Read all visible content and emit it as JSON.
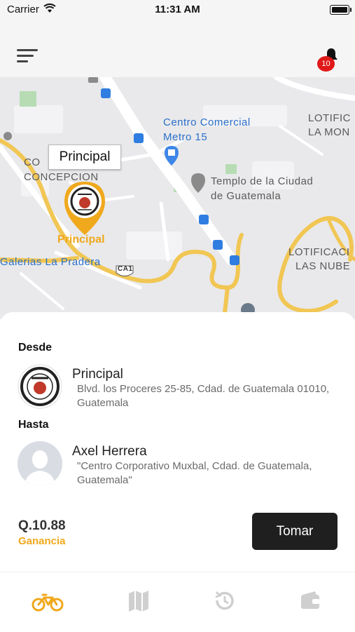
{
  "status_bar": {
    "carrier": "Carrier",
    "time": "11:31 AM"
  },
  "header": {
    "notification_count": "10"
  },
  "map": {
    "callout": "Principal",
    "pin_label": "Principal",
    "labels": {
      "centro_comercial": "Centro Comercial",
      "metro_15": "Metro 15",
      "templo_1": "Templo de la Ciudad",
      "templo_2": "de Guatemala",
      "lotif_la_mon_1": "LOTIFIC",
      "lotif_la_mon_2": "LA MON",
      "concepcion_1": "CO",
      "concepcion_2": "CONCEPCION",
      "galerias": "Galerias La Pradera",
      "ca1": "CA1",
      "lotif_nube_1": "LOTIFICACI",
      "lotif_nube_2": "LAS NUBE"
    }
  },
  "order": {
    "from_title": "Desde",
    "from_name": "Principal",
    "from_address": "Blvd. los Proceres 25-85, Cdad. de Guatemala 01010, Guatemala",
    "to_title": "Hasta",
    "to_name": "Axel Herrera",
    "to_address": "\"Centro Corporativo Muxbal, Cdad. de Guatemala, Guatemala\"",
    "amount": "Q.10.88",
    "earning_label": "Ganancia",
    "accept_label": "Tomar"
  },
  "tabs": [
    {
      "icon": "bicycle-icon",
      "active": true
    },
    {
      "icon": "map-icon",
      "active": false
    },
    {
      "icon": "history-icon",
      "active": false
    },
    {
      "icon": "wallet-icon",
      "active": false
    }
  ],
  "colors": {
    "accent": "#f0a81c",
    "badge": "#e01919",
    "button": "#1f1f1f"
  }
}
